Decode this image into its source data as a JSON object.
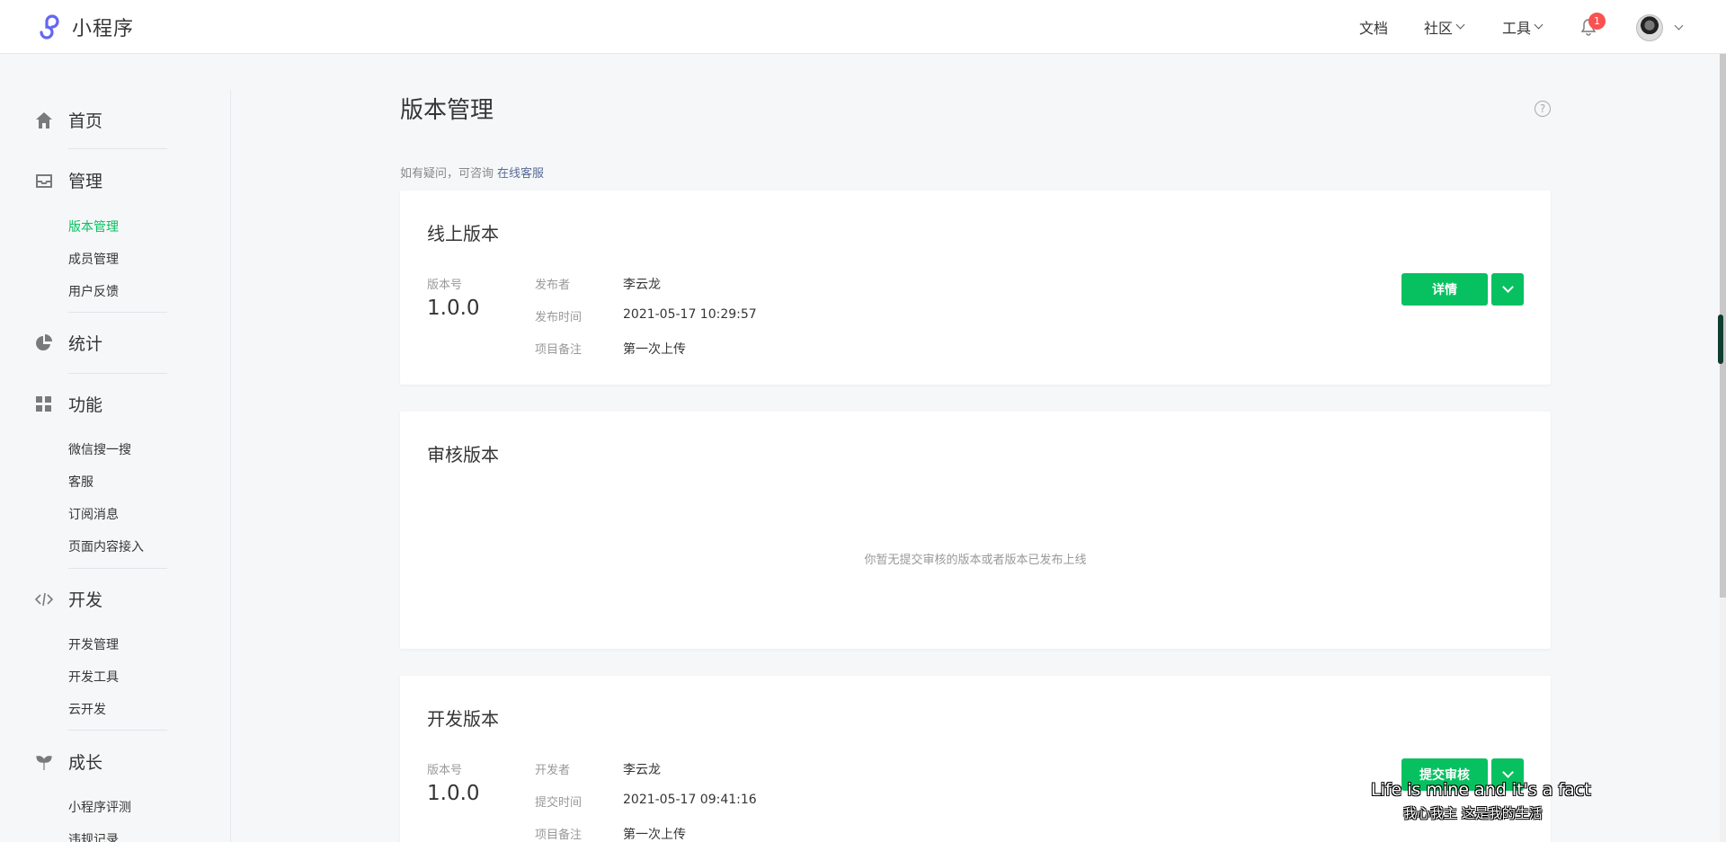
{
  "header": {
    "logo_text": "小程序",
    "nav": [
      "文档",
      "社区",
      "工具"
    ],
    "notification_count": "1"
  },
  "sidebar": {
    "sections": [
      {
        "label": "首页",
        "icon": "home-icon",
        "items": []
      },
      {
        "label": "管理",
        "icon": "inbox-icon",
        "items": [
          "版本管理",
          "成员管理",
          "用户反馈"
        ]
      },
      {
        "label": "统计",
        "icon": "pie-chart-icon",
        "items": []
      },
      {
        "label": "功能",
        "icon": "grid-icon",
        "items": [
          "微信搜一搜",
          "客服",
          "订阅消息",
          "页面内容接入"
        ]
      },
      {
        "label": "开发",
        "icon": "code-icon",
        "items": [
          "开发管理",
          "开发工具",
          "云开发"
        ]
      },
      {
        "label": "成长",
        "icon": "sprout-icon",
        "items": [
          "小程序评测",
          "违规记录"
        ]
      }
    ],
    "active_item": "版本管理"
  },
  "main": {
    "title": "版本管理",
    "help": "?",
    "tip_text": "如有疑问，可咨询",
    "tip_link": "在线客服",
    "online": {
      "title": "线上版本",
      "version_label": "版本号",
      "version": "1.0.0",
      "meta": [
        {
          "key": "发布者",
          "value": "李云龙"
        },
        {
          "key": "发布时间",
          "value": "2021-05-17 10:29:57"
        },
        {
          "key": "项目备注",
          "value": "第一次上传"
        }
      ],
      "button": "详情"
    },
    "review": {
      "title": "审核版本",
      "empty_text": "你暂无提交审核的版本或者版本已发布上线"
    },
    "dev": {
      "title": "开发版本",
      "version_label": "版本号",
      "version": "1.0.0",
      "meta": [
        {
          "key": "开发者",
          "value": "李云龙"
        },
        {
          "key": "提交时间",
          "value": "2021-05-17 09:41:16"
        },
        {
          "key": "项目备注",
          "value": "第一次上传"
        }
      ],
      "button": "提交审核"
    }
  },
  "overlay": {
    "subtitle_en": "Life is mine and it's a fact",
    "subtitle_cn": "我心我主  这是我的生活"
  },
  "colors": {
    "accent": "#07c160",
    "link": "#576b95",
    "badge": "#fa5151"
  }
}
